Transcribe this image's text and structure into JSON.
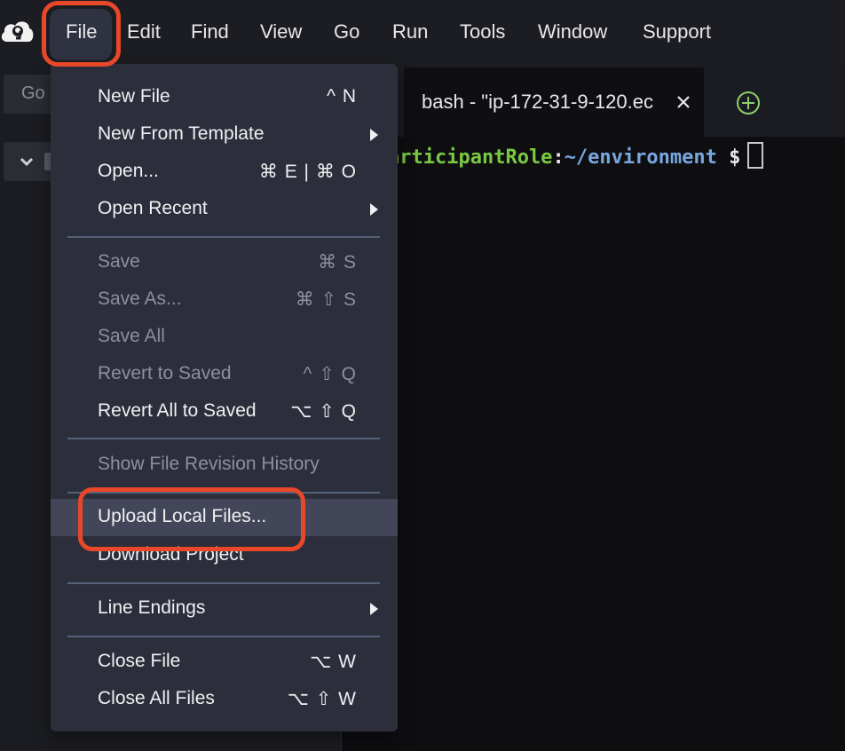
{
  "menubar": {
    "items": [
      "File",
      "Edit",
      "Find",
      "View",
      "Go",
      "Run",
      "Tools",
      "Window",
      "Support"
    ],
    "logo_icon": "cloud9-logo-icon"
  },
  "sidebar": {
    "goto_placeholder": "Go"
  },
  "editor": {
    "tab_label": "bash - \"ip-172-31-9-120.ec",
    "terminal": {
      "role": "articipantRole",
      "colon": ":",
      "path": "~/environment",
      "dollar": "$"
    }
  },
  "file_menu": {
    "items": [
      {
        "label": "New File",
        "shortcut": "^ N",
        "enabled": true
      },
      {
        "label": "New From Template",
        "submenu": true,
        "enabled": true
      },
      {
        "label": "Open...",
        "shortcut": "⌘ E | ⌘ O",
        "enabled": true
      },
      {
        "label": "Open Recent",
        "submenu": true,
        "enabled": true
      },
      {
        "label": "Save",
        "shortcut": "⌘ S",
        "enabled": false
      },
      {
        "label": "Save As...",
        "shortcut": "⌘ ⇧ S",
        "enabled": false
      },
      {
        "label": "Save All",
        "enabled": false
      },
      {
        "label": "Revert to Saved",
        "shortcut": "^ ⇧ Q",
        "enabled": false
      },
      {
        "label": "Revert All to Saved",
        "shortcut": "⌥ ⇧ Q",
        "enabled": true
      },
      {
        "label": "Show File Revision History",
        "enabled": false
      },
      {
        "label": "Upload Local Files...",
        "enabled": true,
        "highlighted": true
      },
      {
        "label": "Download Project",
        "enabled": true
      },
      {
        "label": "Line Endings",
        "submenu": true,
        "enabled": true
      },
      {
        "label": "Close File",
        "shortcut": "⌥ W",
        "enabled": true
      },
      {
        "label": "Close All Files",
        "shortcut": "⌥ ⇧ W",
        "enabled": true
      }
    ]
  },
  "colors": {
    "highlight_ring": "#e8472a",
    "menu_bg": "#2c2f3b",
    "prompt_green": "#7ac943",
    "prompt_blue": "#7aa6e0"
  }
}
